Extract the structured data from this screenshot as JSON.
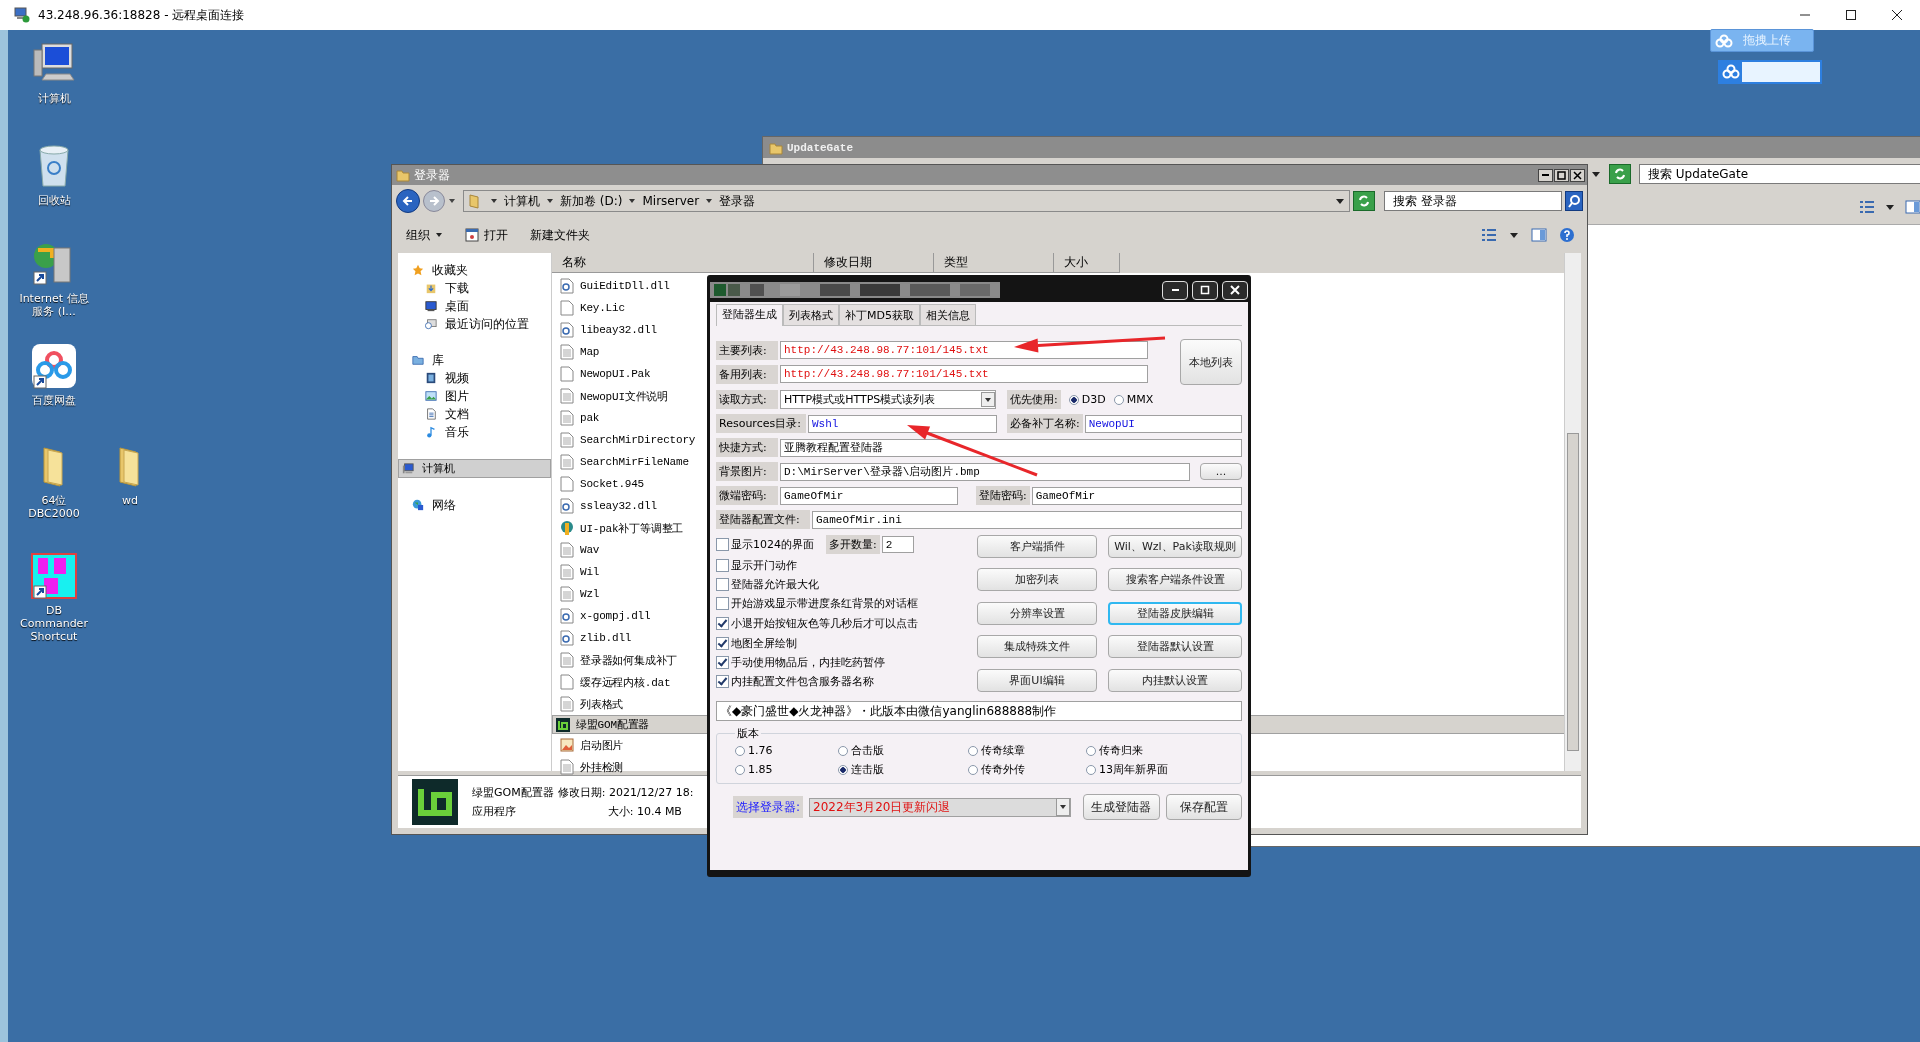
{
  "remote_window": {
    "title": "43.248.96.36:18828 - 远程桌面连接"
  },
  "desktop_icons": [
    {
      "label": "计算机",
      "kind": "computer"
    },
    {
      "label": "回收站",
      "kind": "recycle"
    },
    {
      "label": "Internet 信息服务 (I...",
      "kind": "server"
    },
    {
      "label": "百度网盘",
      "kind": "cloud"
    },
    {
      "label": "64位DBC2000",
      "kind": "folder"
    },
    {
      "label": "wd",
      "kind": "folder"
    },
    {
      "label": "DB Commander Shortcut",
      "kind": "dbc"
    }
  ],
  "upload_widget": {
    "button": "拖拽上传"
  },
  "update_window": {
    "title": "UpdateGate",
    "search": {
      "placeholder": "搜索 UpdateGate"
    }
  },
  "explorer": {
    "title": "登录器",
    "breadcrumb": [
      "计算机",
      "新加卷 (D:)",
      "Mirserver",
      "登录器"
    ],
    "search": {
      "placeholder": "搜索 登录器"
    },
    "toolbar": [
      "组织",
      "打开",
      "新建文件夹"
    ],
    "nav": [
      {
        "label": "收藏夹",
        "kind": "star",
        "selected": false,
        "children": [
          {
            "label": "下载",
            "kind": "download",
            "selected": false
          },
          {
            "label": "桌面",
            "kind": "desktop",
            "selected": false
          },
          {
            "label": "最近访问的位置",
            "kind": "recent",
            "selected": false
          }
        ]
      },
      {
        "label": "库",
        "kind": "library",
        "selected": false,
        "children": [
          {
            "label": "视频",
            "kind": "video",
            "selected": false
          },
          {
            "label": "图片",
            "kind": "picture",
            "selected": false
          },
          {
            "label": "文档",
            "kind": "document",
            "selected": false
          },
          {
            "label": "音乐",
            "kind": "music",
            "selected": false
          }
        ]
      },
      {
        "label": "计算机",
        "kind": "computer",
        "selected": true
      },
      {
        "label": "网络",
        "kind": "network",
        "selected": false
      }
    ],
    "columns": [
      "名称",
      "修改日期",
      "类型",
      "大小"
    ],
    "files": [
      {
        "name": "GuiEditDll.dll",
        "kind": "dll",
        "selected": false
      },
      {
        "name": "Key.Lic",
        "kind": "file",
        "selected": false
      },
      {
        "name": "libeay32.dll",
        "kind": "dll",
        "selected": false
      },
      {
        "name": "Map",
        "kind": "text",
        "selected": false
      },
      {
        "name": "NewopUI.Pak",
        "kind": "file",
        "selected": false
      },
      {
        "name": "NewopUI文件说明",
        "kind": "text",
        "selected": false
      },
      {
        "name": "pak",
        "kind": "text",
        "selected": false
      },
      {
        "name": "SearchMirDirectory",
        "kind": "text",
        "selected": false
      },
      {
        "name": "SearchMirFileName",
        "kind": "text",
        "selected": false
      },
      {
        "name": "Socket.945",
        "kind": "file",
        "selected": false
      },
      {
        "name": "ssleay32.dll",
        "kind": "dll",
        "selected": false
      },
      {
        "name": "UI-pak补丁等调整工",
        "kind": "tool",
        "selected": false
      },
      {
        "name": "Wav",
        "kind": "text",
        "selected": false
      },
      {
        "name": "Wil",
        "kind": "text",
        "selected": false
      },
      {
        "name": "Wzl",
        "kind": "text",
        "selected": false
      },
      {
        "name": "x-gompj.dll",
        "kind": "dll",
        "selected": false
      },
      {
        "name": "zlib.dll",
        "kind": "dll",
        "selected": false
      },
      {
        "name": "登录器如何集成补丁",
        "kind": "text",
        "selected": false
      },
      {
        "name": "缓存远程内核.dat",
        "kind": "file",
        "selected": false
      },
      {
        "name": "列表格式",
        "kind": "text",
        "selected": false
      },
      {
        "name": "绿盟GOM配置器",
        "kind": "app",
        "selected": true
      },
      {
        "name": "启动图片",
        "kind": "image",
        "selected": false
      },
      {
        "name": "外挂检测",
        "kind": "text",
        "selected": false
      }
    ],
    "details": {
      "name": "绿盟GOM配置器",
      "type": "应用程序",
      "modified": "修改日期: 2021/12/27 18:",
      "size": "大小: 10.4 MB"
    }
  },
  "dialog": {
    "tabs": [
      {
        "label": "登陆器生成",
        "selected": true
      },
      {
        "label": "列表格式",
        "selected": false
      },
      {
        "label": "补丁MD5获取",
        "selected": false
      },
      {
        "label": "相关信息",
        "selected": false
      }
    ],
    "main_list": {
      "label": "主要列表:",
      "value": "http://43.248.98.77:101/145.txt"
    },
    "backup_list": {
      "label": "备用列表:",
      "value": "http://43.248.98.77:101/145.txt"
    },
    "local_list_button": "本地列表",
    "read_mode": {
      "label": "读取方式:",
      "value": "HTTP模式或HTTPS模式读列表"
    },
    "prefer": {
      "label": "优先使用:",
      "options": [
        {
          "label": "D3D",
          "selected": true
        },
        {
          "label": "MMX",
          "selected": false
        }
      ]
    },
    "resources": {
      "label": "Resources目录:",
      "value": "Wshl"
    },
    "required_patch": {
      "label": "必备补丁名称:",
      "value": "NewopUI"
    },
    "shortcut": {
      "label": "快捷方式:",
      "value": "亚腾教程配置登陆器"
    },
    "background": {
      "label": "背景图片:",
      "value": "D:\\MirServer\\登录器\\启动图片.bmp",
      "button": "..."
    },
    "micro_password": {
      "label": "微端密码:",
      "value": "GameOfMir"
    },
    "login_password": {
      "label": "登陆密码:",
      "value": "GameOfMir"
    },
    "config_file": {
      "label": "登陆器配置文件:",
      "value": "GameOfMir.ini"
    },
    "options": [
      {
        "label": "显示1024的界面",
        "checked": false
      },
      {
        "label": "显示开门动作",
        "checked": false
      },
      {
        "label": "登陆器允许最大化",
        "checked": false
      },
      {
        "label": "开始游戏显示带进度条红背景的对话框",
        "checked": false
      },
      {
        "label": "小退开始按钮灰色等几秒后才可以点击",
        "checked": true
      },
      {
        "label": "地图全屏绘制",
        "checked": true
      },
      {
        "label": "手动使用物品后，内挂吃药暂停",
        "checked": true
      },
      {
        "label": "内挂配置文件包含服务器名称",
        "checked": true
      }
    ],
    "instances": {
      "label": "多开数量:",
      "value": "2"
    },
    "buttons": [
      {
        "label": "客户端插件",
        "focused": false
      },
      {
        "label": "Wil、Wzl、Pak读取规则",
        "focused": false
      },
      {
        "label": "加密列表",
        "focused": false
      },
      {
        "label": "搜索客户端条件设置",
        "focused": false
      },
      {
        "label": "分辨率设置",
        "focused": false
      },
      {
        "label": "登陆器皮肤编辑",
        "focused": true
      },
      {
        "label": "集成特殊文件",
        "focused": false
      },
      {
        "label": "登陆器默认设置",
        "focused": false
      },
      {
        "label": "界面UI编辑",
        "focused": false
      },
      {
        "label": "内挂默认设置",
        "focused": false
      }
    ],
    "note": "《◆豪门盛世◆火龙神器》・此版本由微信yanglin688888制作",
    "version": {
      "title": "版本",
      "options": [
        {
          "label": "1.76",
          "selected": false
        },
        {
          "label": "合击版",
          "selected": false
        },
        {
          "label": "传奇续章",
          "selected": false
        },
        {
          "label": "传奇归来",
          "selected": false
        },
        {
          "label": "1.85",
          "selected": false
        },
        {
          "label": "连击版",
          "selected": true
        },
        {
          "label": "传奇外传",
          "selected": false
        },
        {
          "label": "13周年新界面",
          "selected": false
        }
      ]
    },
    "launcher": {
      "label": "选择登录器:",
      "value": "2022年3月20日更新闪退"
    },
    "actions": [
      "生成登陆器",
      "保存配置"
    ]
  }
}
